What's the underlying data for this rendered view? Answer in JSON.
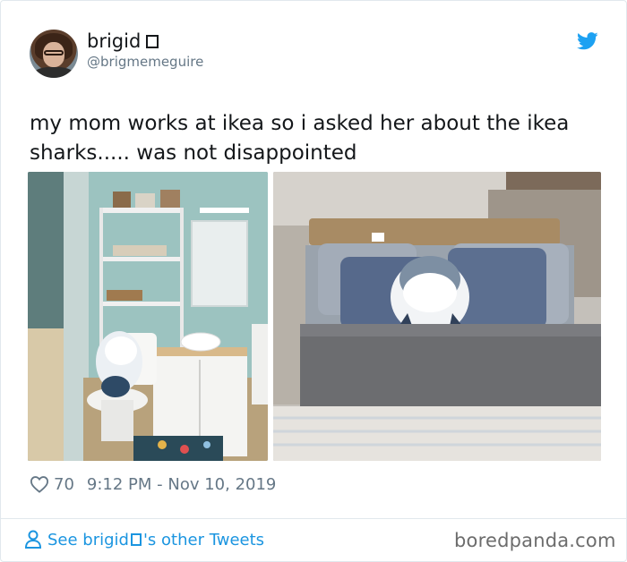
{
  "tweet": {
    "author_name": "brigid",
    "author_handle": "@brigmemeguire",
    "text": "my mom works at ikea so i asked her about the ikea sharks..... was not disappointed",
    "likes": "70",
    "timestamp": "9:12 PM - Nov 10, 2019",
    "photos": [
      {
        "alt": "IKEA shark plush sitting on toilet in bathroom showroom"
      },
      {
        "alt": "IKEA shark plush tucked into bed in bedroom showroom"
      }
    ]
  },
  "footer": {
    "link_prefix": "See brigid ",
    "link_suffix": "'s other Tweets",
    "watermark": "boredpanda.com"
  },
  "colors": {
    "twitter_blue": "#1da1f2",
    "link_blue": "#1b95e0",
    "muted_text": "#657786"
  },
  "icons": {
    "brand": "twitter-bird-icon",
    "like": "heart-icon",
    "profile": "person-icon"
  }
}
